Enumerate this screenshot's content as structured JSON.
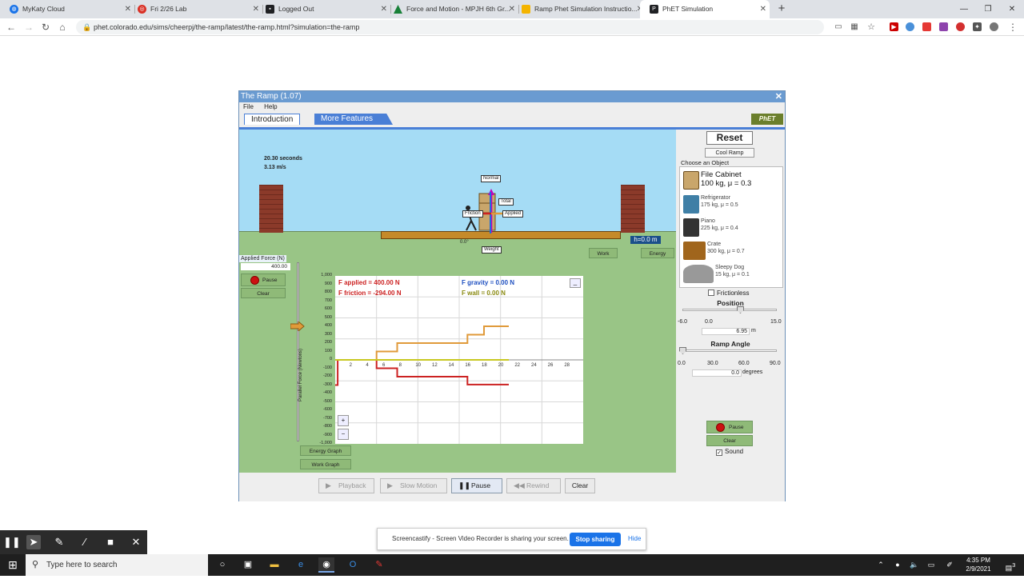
{
  "browser": {
    "tabs": [
      {
        "title": "MyKaty Cloud",
        "icon_color": "#1a73e8"
      },
      {
        "title": "Fri 2/26 Lab",
        "icon_color": "#d93025"
      },
      {
        "title": "Logged Out",
        "icon_color": "#202124"
      },
      {
        "title": "Force and Motion - MPJH 6th Gr...",
        "icon_color": "#188038"
      },
      {
        "title": "Ramp Phet Simulation Instructio...",
        "icon_color": "#f4b400"
      },
      {
        "title": "PhET Simulation",
        "icon_color": "#202124"
      }
    ],
    "new_tab": "+",
    "url": "phet.colorado.edu/sims/cheerpj/the-ramp/latest/the-ramp.html?simulation=the-ramp",
    "window_controls": [
      "—",
      "❐",
      "✕"
    ]
  },
  "app": {
    "title": "The Ramp (1.07)",
    "menu": [
      "File",
      "Help"
    ],
    "tabs": [
      "Introduction",
      "More Features"
    ],
    "logo": "PhET",
    "sim": {
      "time": "20.30 seconds",
      "speed": "3.13 m/s",
      "force_labels": {
        "normal": "Normal",
        "total": "Total",
        "friction": "Friction",
        "applied": "Applied",
        "weight": "Weight"
      },
      "angle": "0.0°",
      "height": "h=0.0 m",
      "work_btn": "Work",
      "energy_btn": "Energy"
    },
    "applied_force": {
      "label": "Applied Force (N)",
      "value": "400.00"
    },
    "left_controls": {
      "pause": "Pause",
      "clear": "Clear"
    },
    "graph": {
      "legend": {
        "applied": "F applied = 400.00 N",
        "friction": "F friction = -294.00 N",
        "gravity": "F gravity = 0.00 N",
        "wall": "F wall = 0.00 N"
      },
      "ylabel": "Parallel Force (Newtons)",
      "yticks": [
        "1,000",
        "900",
        "800",
        "700",
        "600",
        "500",
        "400",
        "300",
        "200",
        "100",
        "0",
        "-100",
        "-200",
        "-300",
        "-400",
        "-500",
        "-600",
        "-700",
        "-800",
        "-900",
        "-1,000"
      ],
      "xticks": [
        "2",
        "4",
        "6",
        "8",
        "10",
        "12",
        "14",
        "16",
        "18",
        "20",
        "22",
        "24",
        "26",
        "28"
      ],
      "minimize": "_",
      "zoom_in": "+",
      "zoom_out": "−"
    },
    "graph_buttons": {
      "energy": "Energy Graph",
      "work": "Work Graph"
    },
    "panel": {
      "reset": "Reset",
      "cool": "Cool Ramp",
      "choose": "Choose an Object",
      "objects": [
        {
          "name": "File Cabinet",
          "spec": "100 kg, μ = 0.3",
          "color": "#c9a66b"
        },
        {
          "name": "Refrigerator",
          "spec": "175 kg, μ = 0.5",
          "color": "#3f7fa6"
        },
        {
          "name": "Piano",
          "spec": "225 kg, μ = 0.4",
          "color": "#333333"
        },
        {
          "name": "Crate",
          "spec": "300 kg, μ = 0.7",
          "color": "#a0651c"
        },
        {
          "name": "Sleepy Dog",
          "spec": "15 kg, μ = 0.1",
          "color": "#999999"
        }
      ],
      "frictionless": "Frictionless",
      "position": {
        "title": "Position",
        "min": "-6.0",
        "mid": "0.0",
        "max": "15.0",
        "value": "6.95",
        "unit": "m"
      },
      "ramp_angle": {
        "title": "Ramp Angle",
        "min": "0.0",
        "mid1": "30.0",
        "mid2": "60.0",
        "max": "90.0",
        "value": "0.0",
        "unit": "degrees"
      },
      "pause": "Pause",
      "clear": "Clear",
      "sound": "Sound"
    },
    "playback": {
      "playback": "Playback",
      "slow": "Slow Motion",
      "pause": "Pause",
      "rewind": "Rewind",
      "clear": "Clear"
    }
  },
  "screencastify": {
    "notice": "Screencastify - Screen Video Recorder is sharing your screen.",
    "stop": "Stop sharing",
    "hide": "Hide"
  },
  "taskbar": {
    "search_placeholder": "Type here to search",
    "time": "4:35 PM",
    "date": "2/9/2021",
    "notif_count": "3"
  },
  "chart_data": {
    "type": "line",
    "ylabel": "Parallel Force (Newtons)",
    "ylim": [
      -1000,
      1000
    ],
    "xlim": [
      0,
      30
    ],
    "series": [
      {
        "name": "F applied",
        "color": "#e09a3a",
        "x": [
          0,
          5,
          5,
          7.5,
          7.5,
          16,
          16,
          18,
          18,
          20,
          20,
          21
        ],
        "y": [
          0,
          0,
          100,
          100,
          200,
          200,
          300,
          300,
          400,
          400,
          400,
          400
        ]
      },
      {
        "name": "F friction",
        "color": "#cc2222",
        "x": [
          0,
          0.3,
          0.3,
          5,
          5,
          7.5,
          7.5,
          16,
          16,
          18,
          18,
          21
        ],
        "y": [
          -300,
          -300,
          0,
          0,
          -100,
          -100,
          -200,
          -200,
          -294,
          -294,
          -294,
          -294
        ]
      },
      {
        "name": "F gravity",
        "color": "#c8c820",
        "x": [
          0,
          21
        ],
        "y": [
          0,
          0
        ]
      }
    ]
  }
}
